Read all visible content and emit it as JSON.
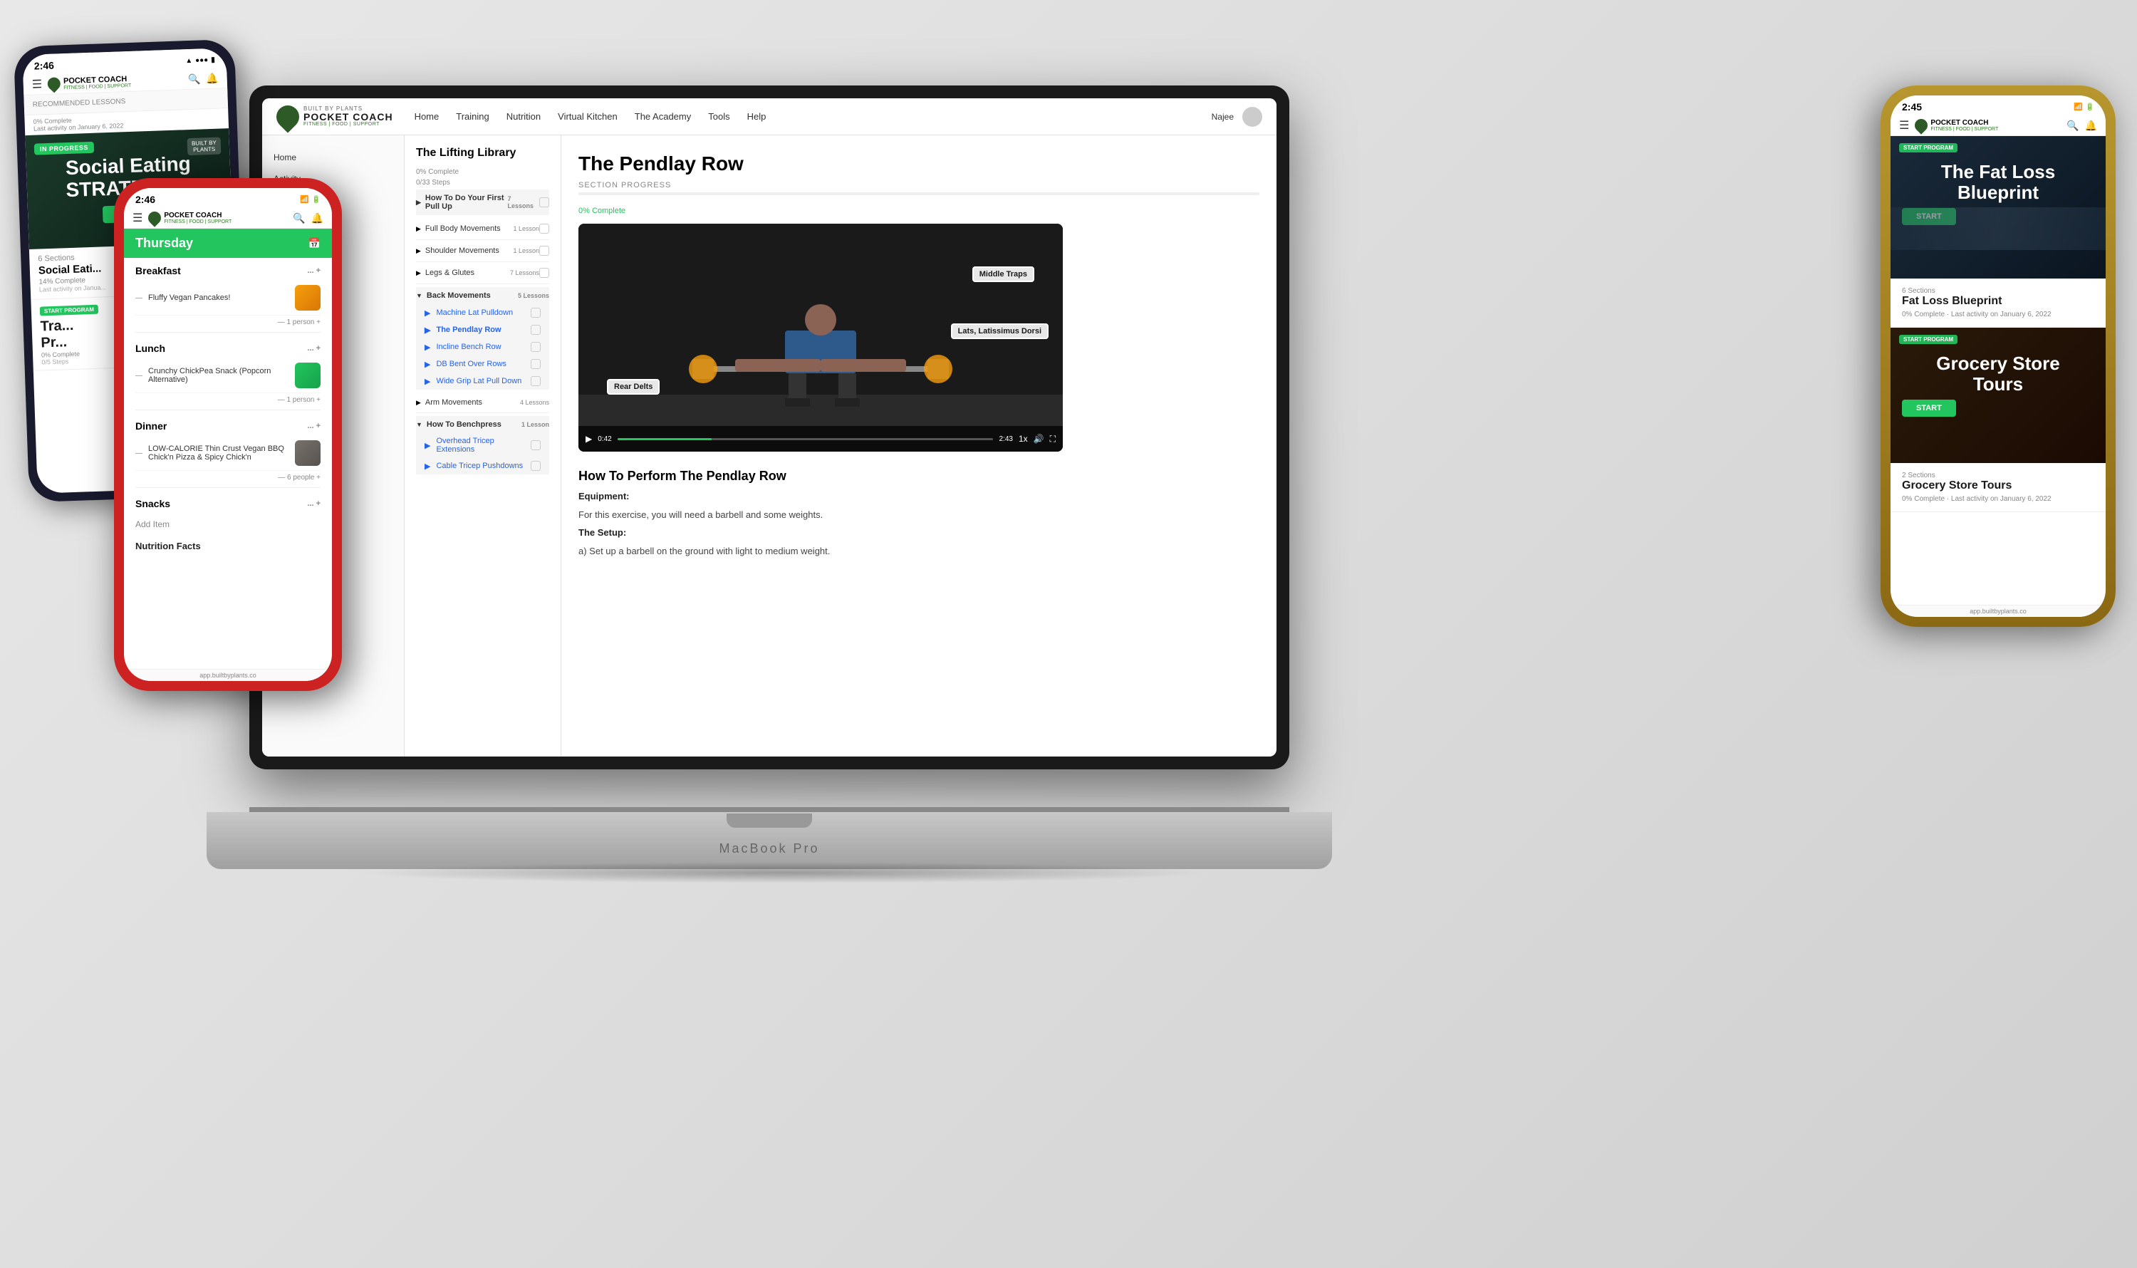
{
  "app": {
    "name": "POCKET COACH",
    "tagline": "FITNESS | FOOD | SUPPORT",
    "built_by": "BUILT BY PLANTS",
    "url": "app.builtbyplants.co"
  },
  "laptop": {
    "title": "MacBook Pro",
    "nav": {
      "links": [
        "Home",
        "Training",
        "Nutrition",
        "Virtual Kitchen",
        "The Academy",
        "Tools",
        "Help"
      ],
      "user": "Najee",
      "sidebar_links": [
        "Home",
        "Activity"
      ]
    },
    "lifting_library": {
      "title": "The Lifting Library",
      "progress": "0% Complete",
      "steps": "0/33 Steps",
      "sections": [
        {
          "name": "How To Do Your First Pull Up",
          "lessons": "7 Lessons",
          "expanded": false
        },
        {
          "name": "Full Body Movements",
          "lessons": "1 Lesson",
          "expanded": false
        },
        {
          "name": "Shoulder Movements",
          "lessons": "1 Lesson",
          "expanded": false
        },
        {
          "name": "Legs & Glutes",
          "lessons": "7 Lessons",
          "expanded": false
        },
        {
          "name": "Back Movements",
          "lessons": "5 Lessons",
          "expanded": true,
          "items": [
            {
              "name": "Machine Lat Pulldown",
              "active": false
            },
            {
              "name": "The Pendlay Row",
              "active": true
            },
            {
              "name": "Incline Bench Row",
              "active": false
            },
            {
              "name": "DB Bent Over Rows",
              "active": false
            },
            {
              "name": "Wide Grip Lat Pull Down",
              "active": false
            }
          ]
        },
        {
          "name": "Arm Movements",
          "lessons": "4 Lessons",
          "expanded": false
        },
        {
          "name": "How To Benchpress",
          "lessons": "1 Lesson",
          "expanded": true,
          "items": [
            {
              "name": "Overhead Tricep Extensions",
              "active": false
            },
            {
              "name": "Cable Tricep Pushdowns",
              "active": false
            }
          ]
        }
      ]
    },
    "video": {
      "title": "The Pendlay Row",
      "section_progress": "SECTION PROGRESS",
      "progress_pct": 0,
      "progress_label": "0% Complete",
      "labels": {
        "middle_traps": "Middle Traps",
        "lats": "Lats, Latissimus Dorsi",
        "rear_delts": "Rear Delts"
      },
      "time_current": "0:42",
      "time_total": "2:43",
      "speed": "1x"
    },
    "exercise": {
      "title": "How To Perform The Pendlay Row",
      "equipment_label": "Equipment:",
      "equipment_text": "For this exercise, you will need a barbell and some weights.",
      "setup_label": "The Setup:",
      "setup_text": "a) Set up a barbell on the ground with light to medium weight."
    }
  },
  "phone_left_behind": {
    "time": "2:46",
    "status": "IN PROGRESS",
    "card_title": "Social Eating\nSTRATEGIES",
    "start_label": "START",
    "sections_count": "6 Sections",
    "course_name": "Social Eati...",
    "progress_pct": "14% Complete",
    "last_activity": "Last activity on Janua...",
    "program_label": "START PROGRAM",
    "track_label": "Track Your\nPr...",
    "track_pct": "0% Complete",
    "track_steps": "0/5 Steps"
  },
  "phone_middle": {
    "time": "2:46",
    "day": "Thursday",
    "url": "app.builtbyplants.co",
    "meals": {
      "breakfast": {
        "title": "Breakfast",
        "items": [
          {
            "name": "Fluffy Vegan Pancakes!",
            "color": "orange"
          }
        ],
        "serving": "1 person"
      },
      "lunch": {
        "title": "Lunch",
        "items": [
          {
            "name": "Crunchy ChickPea Snack (Popcorn Alternative)",
            "color": "green"
          }
        ],
        "serving": "1 person"
      },
      "dinner": {
        "title": "Dinner",
        "items": [
          {
            "name": "LOW-CALORIE Thin Crust Vegan BBQ Chick'n Pizza & Spicy Chick'n",
            "color": "dark"
          }
        ],
        "serving": "6 people"
      },
      "snacks": {
        "title": "Snacks",
        "add_label": "Add Item"
      }
    },
    "nutrition_facts_label": "Nutrition Facts"
  },
  "phone_right": {
    "time": "2:45",
    "url": "app.builtbyplants.co",
    "fat_loss": {
      "start_program": "START PROGRAM",
      "title": "The Fat Loss\nBlueprint",
      "start_label": "START",
      "sections": "6 Sections",
      "name": "Fat Loss Blueprint",
      "progress": "0% Complete",
      "last_activity": "Last activity on January 6, 2022"
    },
    "grocery": {
      "start_program": "START PROGRAM",
      "title": "Grocery Store\nTours",
      "start_label": "START",
      "sections": "2 Sections",
      "name": "Grocery Store Tours",
      "progress": "0% Complete",
      "last_activity": "Last activity on January 6, 2022"
    }
  }
}
